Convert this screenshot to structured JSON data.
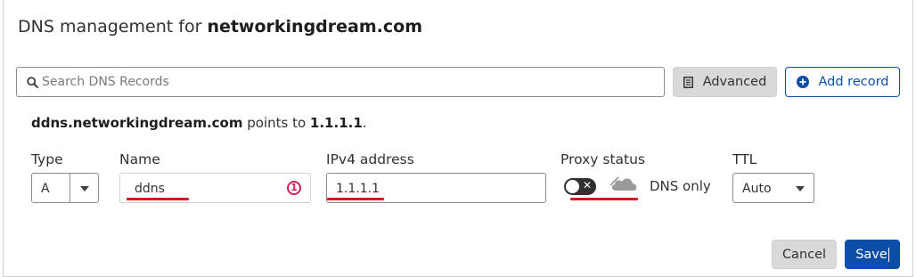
{
  "dialog": {
    "title_prefix": "DNS management for ",
    "title_domain": "networkingdream.com"
  },
  "search": {
    "placeholder": "Search DNS Records",
    "icon": "search-icon"
  },
  "toolbar": {
    "advanced_label": "Advanced",
    "advanced_icon": "document-icon",
    "add_record_label": "Add record",
    "add_record_icon": "plus-circle-icon"
  },
  "summary": {
    "host": "ddns.networkingdream.com",
    "middle": " points to ",
    "target": "1.1.1.1",
    "end": "."
  },
  "form": {
    "type_label": "Type",
    "type_value": "A",
    "name_label": "Name",
    "name_value": "ddns",
    "name_badge": "1",
    "ipv4_label": "IPv4 address",
    "ipv4_value": "1.1.1.1",
    "proxy_label": "Proxy status",
    "proxy_on": false,
    "proxy_text": "DNS only",
    "ttl_label": "TTL",
    "ttl_value": "Auto"
  },
  "actions": {
    "cancel_label": "Cancel",
    "save_label": "Save"
  },
  "colors": {
    "primary": "#0a4ea8",
    "error": "#d0205b",
    "annotation": "#e01020"
  }
}
